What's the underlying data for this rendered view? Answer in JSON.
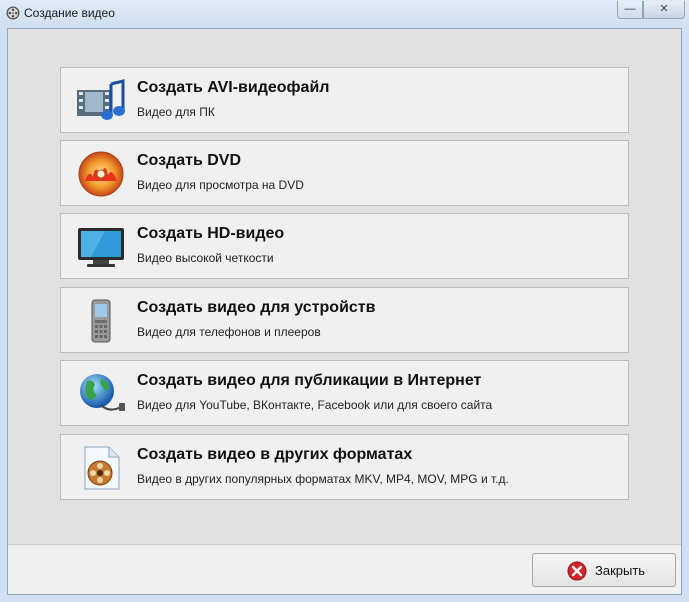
{
  "window": {
    "title": "Создание видео",
    "minimize_glyph": "—",
    "close_glyph": "✕"
  },
  "options": [
    {
      "title": "Создать AVI-видеофайл",
      "subtitle": "Видео для ПК",
      "icon": "film-music-icon"
    },
    {
      "title": "Создать DVD",
      "subtitle": "Видео для просмотра на DVD",
      "icon": "dvd-disc-icon"
    },
    {
      "title": "Создать HD-видео",
      "subtitle": "Видео высокой четкости",
      "icon": "hd-monitor-icon"
    },
    {
      "title": "Создать видео для устройств",
      "subtitle": "Видео для телефонов и плееров",
      "icon": "mobile-phone-icon"
    },
    {
      "title": "Создать видео для публикации в Интернет",
      "subtitle": "Видео для YouTube, ВКонтакте, Facebook или для своего сайта",
      "icon": "globe-internet-icon"
    },
    {
      "title": "Создать видео в других форматах",
      "subtitle": "Видео в других популярных форматах MKV, MP4, MOV, MPG и т.д.",
      "icon": "film-reel-file-icon"
    }
  ],
  "footer": {
    "close_label": "Закрыть"
  }
}
